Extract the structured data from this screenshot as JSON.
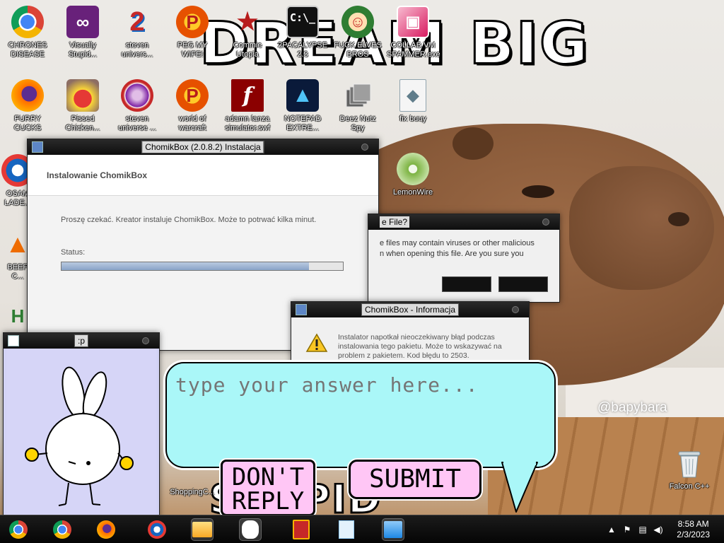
{
  "wallpaper": {
    "headline": "DREAM BIG",
    "watermark": "@bapybara",
    "bottom_text": "STUPID"
  },
  "desktop_icons": [
    {
      "label": "CHRONES\nDISEASE",
      "icon": "chrome-icon",
      "color": "#db4437"
    },
    {
      "label": "Visually\nStupid...",
      "icon": "visual-studio-icon",
      "color": "#68217a"
    },
    {
      "label": "steven\nunivers...",
      "icon": "number-two-icon",
      "color": "#c62828"
    },
    {
      "label": "PEG MY WIFE!",
      "icon": "p-badge-icon",
      "color": "#e65100"
    },
    {
      "label": "Commie\nUtopia",
      "icon": "star-emblem-icon",
      "color": "#b71c1c"
    },
    {
      "label": "2PACALYPSE\n2.3",
      "icon": "terminal-icon",
      "color": "#111111"
    },
    {
      "label": "FUCK ELVES\nBROS",
      "icon": "elf-face-icon",
      "color": "#2e7d32"
    },
    {
      "label": "COLLAB VM\nSPAMMER.exe",
      "icon": "gift-box-icon",
      "color": "#d81b60"
    },
    {
      "label": "FURRY CUCKS",
      "icon": "firefox-icon",
      "color": "#ff6d00"
    },
    {
      "label": "Pissed\nChicken...",
      "icon": "angry-birds-icon",
      "color": "#c62828"
    },
    {
      "label": "steven\nuniverse ...",
      "icon": "gem-icon",
      "color": "#7b1fa2"
    },
    {
      "label": "world of\nwarcraft",
      "icon": "p-badge-icon",
      "color": "#e65100"
    },
    {
      "label": "adamn lanza\nsimulator.swf",
      "icon": "flash-icon",
      "color": "#8b0000"
    },
    {
      "label": "NOTEPAD\nEXTRE...",
      "icon": "arch-logo-icon",
      "color": "#0d47a1"
    },
    {
      "label": "Deez Nutz\nSpy",
      "icon": "stacked-windows-icon",
      "color": "#616161"
    },
    {
      "label": "fix buuy",
      "icon": "script-file-icon",
      "color": "#90a4ae"
    },
    {
      "label": "OSAM\nLADE...",
      "icon": "obama-logo-icon",
      "color": "#1565c0"
    },
    {
      "label": "LemonWire",
      "icon": "lime-icon",
      "color": "#7cb342"
    },
    {
      "label": "BEEP\nC...",
      "icon": "vlc-cone-icon",
      "color": "#ef6c00"
    },
    {
      "label": "H",
      "icon": "h-letter-icon",
      "color": "#2e7d32"
    },
    {
      "label": "ShoppingC...",
      "icon": "shopping-icon",
      "color": "#546e7a"
    },
    {
      "label": "Falcon C++",
      "icon": "recycle-bin-icon",
      "color": "#b0bec5"
    }
  ],
  "window_install": {
    "title": "ChomikBox (2.0.8.2) Instalacja",
    "header": "Instalowanie ChomikBox",
    "message": "Proszę czekać. Kreator instaluje ChomikBox. Może to potrwać kilka minut.",
    "status_label": "Status:",
    "progress_fraction": 0.88
  },
  "window_open_file": {
    "title": "e File?",
    "text": "e files may contain viruses or other malicious\nn when opening this file. Are you sure you"
  },
  "window_info": {
    "title": "ChomikBox - Informacja",
    "message": "Instalator napotkał nieoczekiwany błąd podczas instalowania tego pakietu. Może to wskazywać na problem z pakietem. Kod błędu to 2503."
  },
  "window_bunny": {
    "title": ":p"
  },
  "bubble": {
    "placeholder": "type your answer here...",
    "dont_reply_label": "DON'T\nREPLY",
    "submit_label": "SUBMIT"
  },
  "taskbar": {
    "apps": [
      "chrome-icon",
      "chrome-icon",
      "firefox-icon",
      "obama-logo-icon",
      "file-explorer-icon",
      "bunny-app-icon",
      "red-book-icon",
      "notepad-icon",
      "installer-icon"
    ],
    "time": "8:58 AM",
    "date": "2/3/2023"
  },
  "colors": {
    "bubble": "#aaf7f8",
    "buttons": "#ffc6f5",
    "titlebar": "#111111",
    "progress": "#8aa4c8"
  }
}
